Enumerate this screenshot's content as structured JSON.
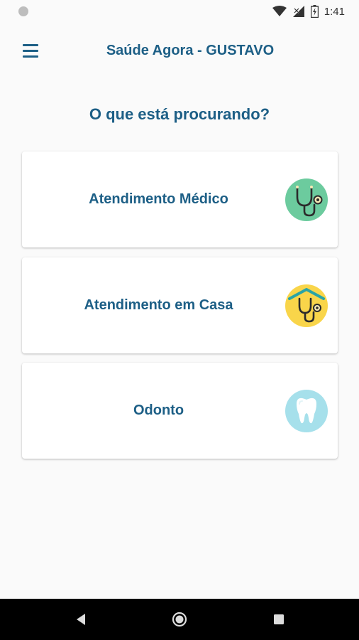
{
  "status_bar": {
    "time": "1:41",
    "icons": [
      "notification-dot-icon",
      "wifi-icon",
      "cellular-icon",
      "battery-icon"
    ]
  },
  "app_bar": {
    "title": "Saúde Agora - GUSTAVO",
    "menu_icon": "hamburger-menu-icon"
  },
  "main": {
    "heading": "O que está procurando?",
    "options": [
      {
        "label": "Atendimento Médico",
        "icon": "stethoscope-icon",
        "icon_bg": "#6ccb9e"
      },
      {
        "label": "Atendimento em Casa",
        "icon": "home-stethoscope-icon",
        "icon_bg": "#f9d54a"
      },
      {
        "label": "Odonto",
        "icon": "tooth-icon",
        "icon_bg": "#a6e0eb"
      }
    ]
  },
  "nav_bar": {
    "buttons": [
      "back-icon",
      "home-icon",
      "recents-icon"
    ]
  },
  "colors": {
    "primary_text": "#1d5f86",
    "background": "#fafafa",
    "card": "#ffffff",
    "nav_bar": "#000000"
  }
}
